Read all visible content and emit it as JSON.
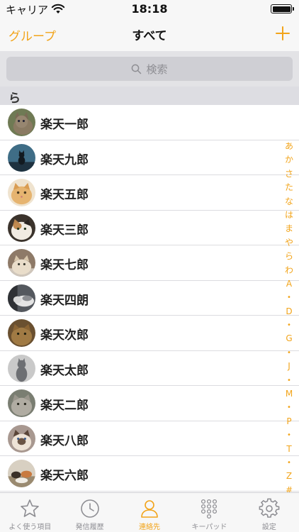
{
  "status_bar": {
    "carrier": "キャリア",
    "time": "18:18",
    "battery_level": 1.0
  },
  "nav": {
    "left_label": "グループ",
    "title": "すべて",
    "add_label": "+"
  },
  "search": {
    "placeholder": "検索",
    "icon": "search-icon"
  },
  "section": {
    "header": "ら"
  },
  "contacts": [
    {
      "name": "楽天一郎",
      "avatar": "cat-photo-tabby"
    },
    {
      "name": "楽天九郎",
      "avatar": "cat-photo-silhouette"
    },
    {
      "name": "楽天五郎",
      "avatar": "cat-photo-orange"
    },
    {
      "name": "楽天三郎",
      "avatar": "cat-photo-calico"
    },
    {
      "name": "楽天七郎",
      "avatar": "cat-photo-cream"
    },
    {
      "name": "楽天四朗",
      "avatar": "cat-photo-sleeping"
    },
    {
      "name": "楽天次郎",
      "avatar": "cat-photo-brown"
    },
    {
      "name": "楽天太郎",
      "avatar": "cat-photo-gray"
    },
    {
      "name": "楽天二郎",
      "avatar": "cat-photo-tabby-gray"
    },
    {
      "name": "楽天八郎",
      "avatar": "cat-photo-siamese"
    },
    {
      "name": "楽天六郎",
      "avatar": "cat-photo-group"
    }
  ],
  "index": [
    "あ",
    "か",
    "さ",
    "た",
    "な",
    "は",
    "ま",
    "や",
    "ら",
    "わ",
    "A",
    "•",
    "D",
    "•",
    "G",
    "•",
    "J",
    "•",
    "M",
    "•",
    "P",
    "•",
    "T",
    "•",
    "Z",
    "#"
  ],
  "tabs": [
    {
      "label": "よく使う項目",
      "icon": "star-icon",
      "active": false
    },
    {
      "label": "発信履歴",
      "icon": "clock-icon",
      "active": false
    },
    {
      "label": "連絡先",
      "icon": "person-icon",
      "active": true
    },
    {
      "label": "キーパッド",
      "icon": "keypad-icon",
      "active": false
    },
    {
      "label": "設定",
      "icon": "gear-icon",
      "active": false
    }
  ],
  "colors": {
    "accent": "#f2a41a",
    "inactive": "#8e8e93"
  }
}
